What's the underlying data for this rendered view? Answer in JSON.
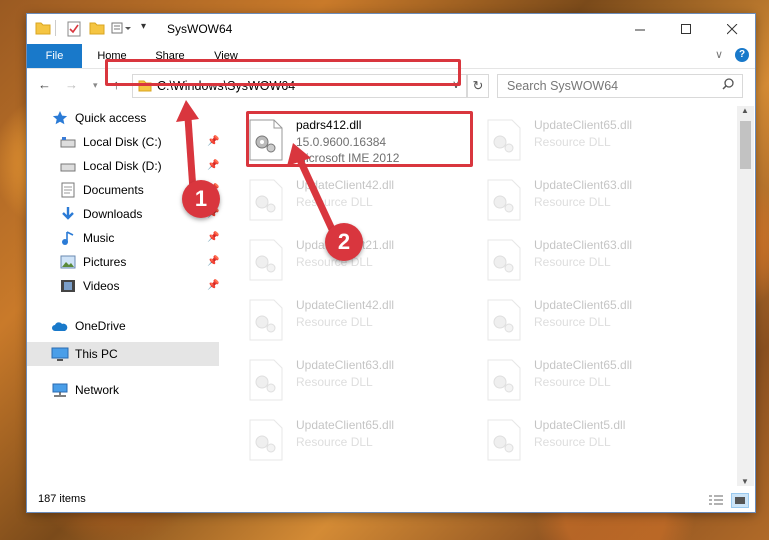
{
  "window": {
    "title": "SysWOW64"
  },
  "ribbon": {
    "tabs": [
      "File",
      "Home",
      "Share",
      "View"
    ]
  },
  "address": {
    "path": "C:\\Windows\\SysWOW64"
  },
  "search": {
    "placeholder": "Search SysWOW64"
  },
  "sidebar": {
    "quick_access": "Quick access",
    "items": [
      {
        "label": "Local Disk (C:)",
        "icon": "drive-icon",
        "pinned": true
      },
      {
        "label": "Local Disk (D:)",
        "icon": "drive-icon",
        "pinned": true
      },
      {
        "label": "Documents",
        "icon": "documents-icon",
        "pinned": true
      },
      {
        "label": "Downloads",
        "icon": "downloads-icon",
        "pinned": true
      },
      {
        "label": "Music",
        "icon": "music-icon",
        "pinned": true
      },
      {
        "label": "Pictures",
        "icon": "pictures-icon",
        "pinned": true
      },
      {
        "label": "Videos",
        "icon": "videos-icon",
        "pinned": true
      }
    ],
    "onedrive": "OneDrive",
    "this_pc": "This PC",
    "network": "Network"
  },
  "files": [
    {
      "name": "padrs412.dll",
      "line2": "15.0.9600.16384",
      "line3": "Microsoft IME 2012"
    },
    {
      "name": "UpdateClient65.dll",
      "line2": "Resource DLL"
    },
    {
      "name": "UpdateClient42.dll",
      "line2": "Resource DLL"
    },
    {
      "name": "UpdateClient63.dll",
      "line2": "Resource DLL"
    },
    {
      "name": "UpdateClient21.dll",
      "line2": "Resource DLL"
    },
    {
      "name": "UpdateClient63.dll",
      "line2": "Resource DLL"
    },
    {
      "name": "UpdateClient42.dll",
      "line2": "Resource DLL"
    },
    {
      "name": "UpdateClient65.dll",
      "line2": "Resource DLL"
    },
    {
      "name": "UpdateClient63.dll",
      "line2": "Resource DLL"
    },
    {
      "name": "UpdateClient65.dll",
      "line2": "Resource DLL"
    },
    {
      "name": "UpdateClient65.dll",
      "line2": "Resource DLL"
    },
    {
      "name": "UpdateClient5.dll",
      "line2": "Resource DLL"
    }
  ],
  "status": {
    "items": "187 items"
  },
  "callouts": [
    "1",
    "2"
  ],
  "colors": {
    "accent": "#1979ca",
    "highlight_red": "#d9363e",
    "selected_bg": "#e5e5e5"
  }
}
